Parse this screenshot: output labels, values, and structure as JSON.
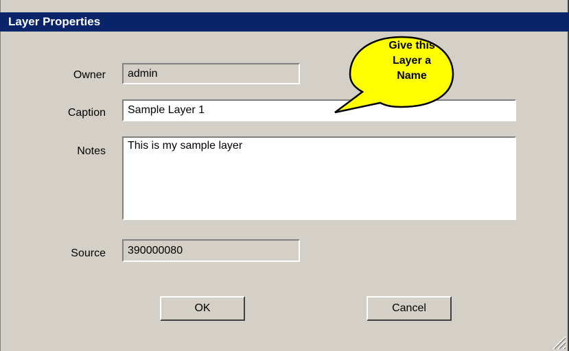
{
  "window": {
    "title": "Layer Properties"
  },
  "form": {
    "owner_label": "Owner",
    "owner_value": "admin",
    "caption_label": "Caption",
    "caption_value": "Sample Layer 1",
    "notes_label": "Notes",
    "notes_value": "This is my sample layer",
    "source_label": "Source",
    "source_value": "390000080"
  },
  "buttons": {
    "ok_label": "OK",
    "cancel_label": "Cancel"
  },
  "callout": {
    "line1": "Give this",
    "line2": "Layer a",
    "line3": "Name",
    "fill_color": "#ffff00"
  },
  "colors": {
    "titlebar": "#0a246a",
    "dialog_bg": "#d4d0c8"
  },
  "icons": {
    "resize_grip": "size-grip-icon"
  }
}
